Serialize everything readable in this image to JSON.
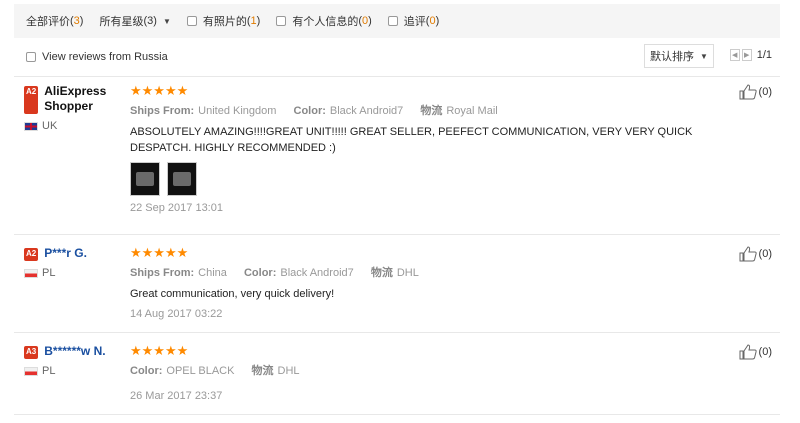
{
  "filters": {
    "all_reviews_label": "全部评价",
    "all_reviews_count": "3",
    "all_stars_label": "所有星级",
    "all_stars_count": "3",
    "with_photos_label": "有照片的",
    "with_photos_count": "1",
    "with_personal_info_label": "有个人信息的",
    "with_personal_info_count": "0",
    "followup_label": "追评",
    "followup_count": "0"
  },
  "toolbar": {
    "russia_label": "View reviews from Russia",
    "sort_label": "默认排序",
    "page_text": "1/1"
  },
  "reviews": [
    {
      "level": "A2",
      "name": "AliExpress Shopper",
      "country": "UK",
      "stars": "★★★★★",
      "ships_from_label": "Ships From:",
      "ships_from": "United Kingdom",
      "color_label": "Color:",
      "color": "Black Android7",
      "logistics_label": "物流",
      "logistics": "Royal Mail",
      "text": "ABSOLUTELY AMAZING!!!!GREAT UNIT!!!!! GREAT SELLER, PEEFECT COMMUNICATION, VERY VERY QUICK DESPATCH. HIGHLY RECOMMENDED :)",
      "date": "22 Sep 2017 13:01",
      "likes": "(0)"
    },
    {
      "level": "A2",
      "name": "P***r G.",
      "country": "PL",
      "stars": "★★★★★",
      "ships_from_label": "Ships From:",
      "ships_from": "China",
      "color_label": "Color:",
      "color": "Black Android7",
      "logistics_label": "物流",
      "logistics": "DHL",
      "text": "Great communication, very quick delivery!",
      "date": "14 Aug 2017 03:22",
      "likes": "(0)"
    },
    {
      "level": "A3",
      "name": "B******w N.",
      "country": "PL",
      "stars": "★★★★★",
      "color_label": "Color:",
      "color": "OPEL BLACK",
      "logistics_label": "物流",
      "logistics": "DHL",
      "date": "26 Mar 2017 23:37",
      "likes": "(0)"
    }
  ],
  "colors": {
    "star": "#ff8a00",
    "count_highlight": "#e07b00",
    "level_badge": "#d9381e",
    "username_link": "#1a4fa0"
  },
  "icons": [
    "chevron-down-icon",
    "checkbox-icon",
    "thumbs-up-icon",
    "prev-page-icon",
    "next-page-icon",
    "flag-uk-icon",
    "flag-pl-icon"
  ]
}
